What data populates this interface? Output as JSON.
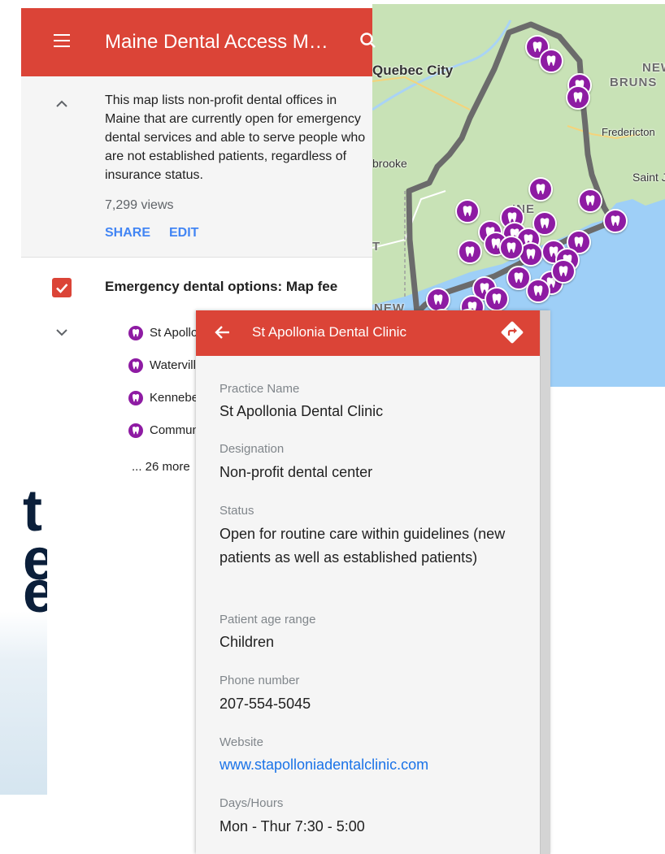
{
  "panel": {
    "title": "Maine Dental Access M…",
    "description": "This map lists non-profit dental offices in Maine that are currently open for emergency dental services and able to serve people who are not established patients, regardless of insurance status.",
    "views": "7,299 views",
    "share_label": "SHARE",
    "edit_label": "EDIT",
    "layer_title": "Emergency dental options: Map fee",
    "items": [
      {
        "label": "St Apollon"
      },
      {
        "label": "Waterville"
      },
      {
        "label": "Kennebec"
      },
      {
        "label": "Communit"
      }
    ],
    "more_label": "... 26 more"
  },
  "map": {
    "labels": {
      "quebec": "Quebec City",
      "new": "NEW",
      "bruns": "BRUNS",
      "fredericton": "Fredericton",
      "saint": "Saint J",
      "brooke": "brooke",
      "ine": "INE",
      "t": "T",
      "newbottom": "NEW"
    },
    "marker_color": "#8e1ba3",
    "water_color": "#9ecff7",
    "land_color": "#c8e2b6"
  },
  "card": {
    "title": "St Apollonia Dental Clinic",
    "fields": [
      {
        "label": "Practice Name",
        "value": "St Apollonia Dental Clinic"
      },
      {
        "label": "Designation",
        "value": "Non-profit dental center"
      },
      {
        "label": "Status",
        "value": "Open for routine care within guidelines (new patients as well as established patients)"
      },
      {
        "label": "Patient age range",
        "value": "Children"
      },
      {
        "label": "Phone number",
        "value": "207-554-5045"
      },
      {
        "label": "Website",
        "value": "www.stapolloniadentalclinic.com"
      },
      {
        "label": "Days/Hours",
        "value": "Mon - Thur 7:30 - 5:00"
      }
    ]
  },
  "colors": {
    "header_red": "#db4437",
    "link_blue": "#4285f4",
    "website_blue": "#1a73e8"
  }
}
